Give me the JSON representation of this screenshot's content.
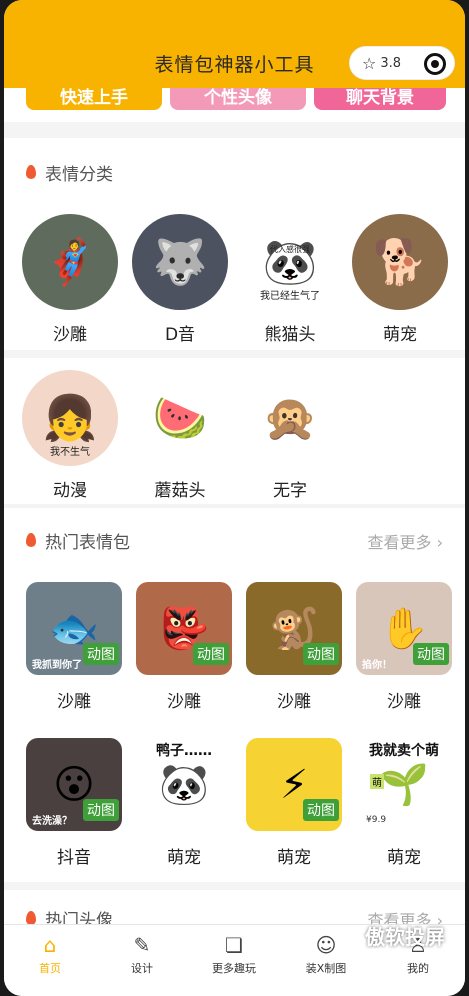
{
  "header": {
    "title": "表情包神器小工具",
    "rating": "3.8"
  },
  "quick_buttons": [
    {
      "label": "快速上手",
      "color": "#f8b200"
    },
    {
      "label": "个性头像",
      "color": "#f39ab8"
    },
    {
      "label": "聊天背景",
      "color": "#f06699"
    }
  ],
  "categories": {
    "title": "表情分类",
    "items": [
      {
        "label": "沙雕",
        "emoji": "🦸",
        "bg": "#5f6b5c"
      },
      {
        "label": "D音",
        "emoji": "🐺",
        "bg": "#4d5260"
      },
      {
        "label": "熊猫头",
        "emoji": "🐼",
        "bg": "#ffffff",
        "caption": "我已经生气了",
        "caption_top": "代入感很强"
      },
      {
        "label": "萌宠",
        "emoji": "🐕",
        "bg": "#8a6b4a"
      },
      {
        "label": "动漫",
        "emoji": "👧",
        "bg": "#f3d7c9",
        "caption": "我不生气"
      },
      {
        "label": "蘑菇头",
        "emoji": "🍉",
        "bg": "#ffffff"
      },
      {
        "label": "无字",
        "emoji": "🙊",
        "bg": "#ffffff"
      }
    ]
  },
  "hot_packs": {
    "title": "热门表情包",
    "more": "查看更多",
    "badge": "动图",
    "items": [
      {
        "label": "沙雕",
        "emoji": "🐟",
        "bg": "#6f7f8a",
        "gif": true,
        "caption": "我抓到你了"
      },
      {
        "label": "沙雕",
        "emoji": "👺",
        "bg": "#b06a4a",
        "gif": true
      },
      {
        "label": "沙雕",
        "emoji": "🐒",
        "bg": "#8a6a2a",
        "gif": true
      },
      {
        "label": "沙雕",
        "emoji": "✋",
        "bg": "#d8c6bb",
        "gif": true,
        "caption": "掐你！"
      },
      {
        "label": "抖音",
        "emoji": "😮",
        "bg": "#4a4040",
        "gif": true,
        "caption": "去洗澡？"
      },
      {
        "label": "萌宠",
        "emoji": "🐼",
        "bg": "#ffffff",
        "gif": false,
        "caption_top": "鸭子……"
      },
      {
        "label": "萌宠",
        "emoji": "⚡",
        "bg": "#f6d332",
        "gif": true
      },
      {
        "label": "萌宠",
        "emoji": "🌱",
        "bg": "#ffffff",
        "gif": false,
        "caption_top": "我就卖个萌",
        "price": "¥9.9",
        "tag": "萌"
      }
    ]
  },
  "avatars": {
    "title": "热门头像",
    "more": "查看更多"
  },
  "tabbar": [
    {
      "label": "首页",
      "icon": "home-icon",
      "glyph": "⌂",
      "active": true
    },
    {
      "label": "设计",
      "icon": "edit-icon",
      "glyph": "✎",
      "active": false
    },
    {
      "label": "更多趣玩",
      "icon": "document-icon",
      "glyph": "❏",
      "active": false
    },
    {
      "label": "装X制图",
      "icon": "face-icon",
      "glyph": "☺",
      "active": false
    },
    {
      "label": "我的",
      "icon": "user-icon",
      "glyph": "♙",
      "active": false
    }
  ],
  "watermark": "傲软投屏"
}
